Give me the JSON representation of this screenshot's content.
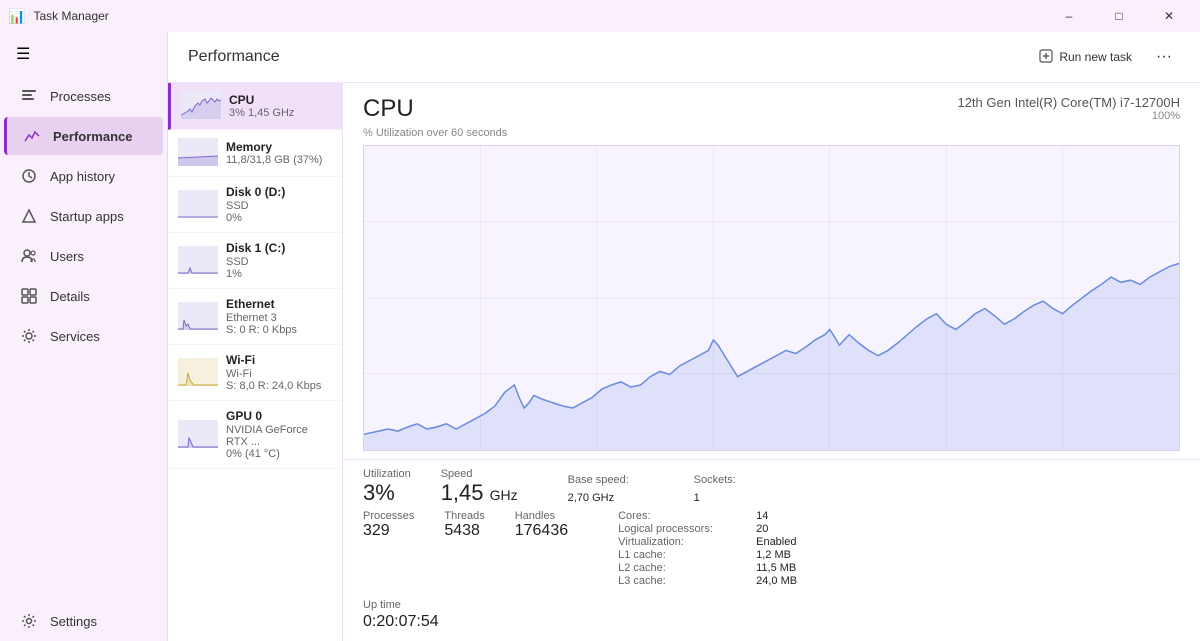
{
  "titleBar": {
    "icon": "📊",
    "title": "Task Manager",
    "minimize": "–",
    "maximize": "□",
    "close": "✕"
  },
  "sidebar": {
    "hamburger": "☰",
    "items": [
      {
        "id": "processes",
        "label": "Processes",
        "icon": "processes"
      },
      {
        "id": "performance",
        "label": "Performance",
        "icon": "performance",
        "active": true
      },
      {
        "id": "app-history",
        "label": "App history",
        "icon": "app-history"
      },
      {
        "id": "startup-apps",
        "label": "Startup apps",
        "icon": "startup"
      },
      {
        "id": "users",
        "label": "Users",
        "icon": "users"
      },
      {
        "id": "details",
        "label": "Details",
        "icon": "details"
      },
      {
        "id": "services",
        "label": "Services",
        "icon": "services"
      }
    ],
    "bottom": [
      {
        "id": "settings",
        "label": "Settings",
        "icon": "settings"
      }
    ]
  },
  "header": {
    "title": "Performance",
    "runNewTask": "Run new task",
    "more": "···"
  },
  "devices": [
    {
      "id": "cpu",
      "name": "CPU",
      "sub": "3% 1,45 GHz",
      "active": true,
      "sparkType": "cpu"
    },
    {
      "id": "memory",
      "name": "Memory",
      "sub": "11,8/31,8 GB (37%)",
      "sparkType": "memory"
    },
    {
      "id": "disk0",
      "name": "Disk 0 (D:)",
      "sub2": "SSD",
      "sub": "0%",
      "sparkType": "flat"
    },
    {
      "id": "disk1",
      "name": "Disk 1 (C:)",
      "sub2": "SSD",
      "sub": "1%",
      "sparkType": "low"
    },
    {
      "id": "ethernet",
      "name": "Ethernet",
      "sub2": "Ethernet 3",
      "sub": "S: 0  R: 0 Kbps",
      "sparkType": "ethernet"
    },
    {
      "id": "wifi",
      "name": "Wi-Fi",
      "sub2": "Wi-Fi",
      "sub": "S: 8,0  R: 24,0 Kbps",
      "sparkType": "wifi"
    },
    {
      "id": "gpu0",
      "name": "GPU 0",
      "sub2": "NVIDIA GeForce RTX ...",
      "sub": "0% (41 °C)",
      "sparkType": "gpu"
    }
  ],
  "cpuSection": {
    "title": "CPU",
    "model": "12th Gen Intel(R) Core(TM) i7-12700H",
    "utilPercent": "100%",
    "subtitle": "% Utilization over 60 seconds"
  },
  "stats": {
    "utilization": {
      "label": "Utilization",
      "value": "3%",
      "unit": ""
    },
    "speed": {
      "label": "Speed",
      "value": "1,45",
      "unit": "GHz"
    },
    "processes": {
      "label": "Processes",
      "value": "329"
    },
    "threads": {
      "label": "Threads",
      "value": "5438"
    },
    "handles": {
      "label": "Handles",
      "value": "176436"
    },
    "uptime": {
      "label": "Up time",
      "value": "0:20:07:54"
    }
  },
  "details": {
    "baseSpeed": {
      "key": "Base speed:",
      "val": "2,70 GHz"
    },
    "sockets": {
      "key": "Sockets:",
      "val": "1"
    },
    "cores": {
      "key": "Cores:",
      "val": "14"
    },
    "logicalProc": {
      "key": "Logical processors:",
      "val": "20"
    },
    "virtualization": {
      "key": "Virtualization:",
      "val": "Enabled"
    },
    "l1cache": {
      "key": "L1 cache:",
      "val": "1,2 MB"
    },
    "l2cache": {
      "key": "L2 cache:",
      "val": "11,5 MB"
    },
    "l3cache": {
      "key": "L3 cache:",
      "val": "24,0 MB"
    }
  }
}
